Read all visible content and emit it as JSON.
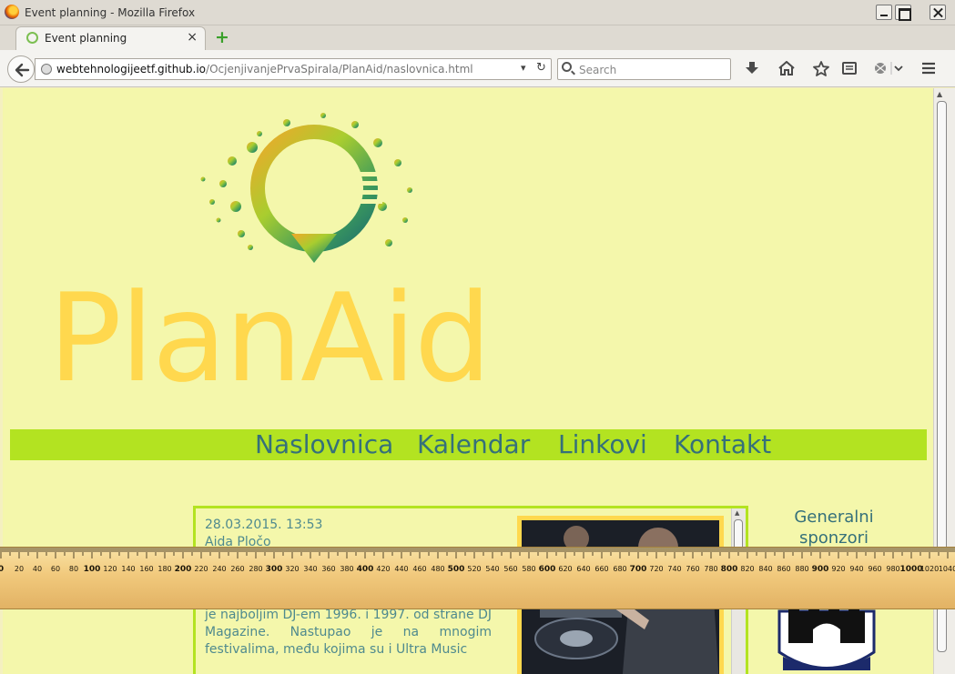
{
  "window": {
    "title": "Event planning - Mozilla Firefox",
    "tab_label": "Event planning",
    "tab_close": "×",
    "new_tab": "+"
  },
  "navbar": {
    "url_host": "webtehnologijeetf.github.io",
    "url_path": "/OcjenjivanjePrvaSpirala/PlanAid/naslovnica.html",
    "search_placeholder": "Search"
  },
  "page": {
    "brand": "PlanAid",
    "menu": [
      "Naslovnica",
      "Kalendar",
      "Linkovi",
      "Kontakt"
    ],
    "post": {
      "date": "28.03.2015. 13:53",
      "author": "Aida Pločo",
      "body": "globalnu techno i house zvijezdu. Proglašen je najboljim DJ-em 1996. i 1997. od strane DJ Magazine. Nastupao je na mnogim festivalima, među kojima su i Ultra Music"
    },
    "sponsors_heading": "Generalni sponzori"
  },
  "ruler": {
    "labels": [
      "0",
      "20",
      "40",
      "60",
      "80",
      "100",
      "120",
      "140",
      "160",
      "180",
      "200",
      "220",
      "240",
      "260",
      "280",
      "300",
      "320",
      "340",
      "360",
      "380",
      "400",
      "420",
      "440",
      "460",
      "480",
      "500",
      "520",
      "540",
      "560",
      "580",
      "600",
      "620",
      "640",
      "660",
      "680",
      "700",
      "720",
      "740",
      "760",
      "780",
      "800",
      "820",
      "840",
      "860",
      "880",
      "900",
      "920",
      "940",
      "960",
      "980",
      "1000",
      "1020",
      "1040"
    ]
  },
  "icons": {
    "back": "back-arrow-icon",
    "globe": "globe-icon",
    "reload": "reload-icon",
    "search": "search-icon",
    "download": "download-icon",
    "home": "home-icon",
    "bookmark": "star-icon",
    "reading_list": "reader-icon",
    "menu": "hamburger-icon"
  },
  "colors": {
    "page_bg": "#f4f7ab",
    "brand": "#ffd84e",
    "menu_bar": "#b3e321",
    "menu_text": "#35707a",
    "post_text": "#4f8a8e"
  }
}
